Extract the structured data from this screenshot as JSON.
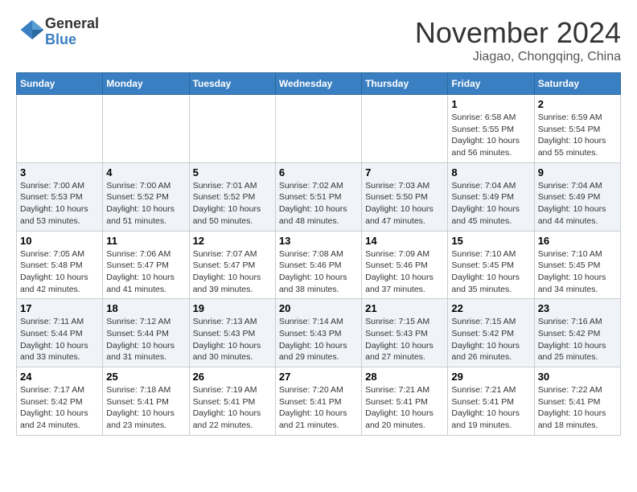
{
  "header": {
    "logo_line1": "General",
    "logo_line2": "Blue",
    "month": "November 2024",
    "location": "Jiagao, Chongqing, China"
  },
  "weekdays": [
    "Sunday",
    "Monday",
    "Tuesday",
    "Wednesday",
    "Thursday",
    "Friday",
    "Saturday"
  ],
  "weeks": [
    [
      {
        "day": "",
        "info": ""
      },
      {
        "day": "",
        "info": ""
      },
      {
        "day": "",
        "info": ""
      },
      {
        "day": "",
        "info": ""
      },
      {
        "day": "",
        "info": ""
      },
      {
        "day": "1",
        "info": "Sunrise: 6:58 AM\nSunset: 5:55 PM\nDaylight: 10 hours and 56 minutes."
      },
      {
        "day": "2",
        "info": "Sunrise: 6:59 AM\nSunset: 5:54 PM\nDaylight: 10 hours and 55 minutes."
      }
    ],
    [
      {
        "day": "3",
        "info": "Sunrise: 7:00 AM\nSunset: 5:53 PM\nDaylight: 10 hours and 53 minutes."
      },
      {
        "day": "4",
        "info": "Sunrise: 7:00 AM\nSunset: 5:52 PM\nDaylight: 10 hours and 51 minutes."
      },
      {
        "day": "5",
        "info": "Sunrise: 7:01 AM\nSunset: 5:52 PM\nDaylight: 10 hours and 50 minutes."
      },
      {
        "day": "6",
        "info": "Sunrise: 7:02 AM\nSunset: 5:51 PM\nDaylight: 10 hours and 48 minutes."
      },
      {
        "day": "7",
        "info": "Sunrise: 7:03 AM\nSunset: 5:50 PM\nDaylight: 10 hours and 47 minutes."
      },
      {
        "day": "8",
        "info": "Sunrise: 7:04 AM\nSunset: 5:49 PM\nDaylight: 10 hours and 45 minutes."
      },
      {
        "day": "9",
        "info": "Sunrise: 7:04 AM\nSunset: 5:49 PM\nDaylight: 10 hours and 44 minutes."
      }
    ],
    [
      {
        "day": "10",
        "info": "Sunrise: 7:05 AM\nSunset: 5:48 PM\nDaylight: 10 hours and 42 minutes."
      },
      {
        "day": "11",
        "info": "Sunrise: 7:06 AM\nSunset: 5:47 PM\nDaylight: 10 hours and 41 minutes."
      },
      {
        "day": "12",
        "info": "Sunrise: 7:07 AM\nSunset: 5:47 PM\nDaylight: 10 hours and 39 minutes."
      },
      {
        "day": "13",
        "info": "Sunrise: 7:08 AM\nSunset: 5:46 PM\nDaylight: 10 hours and 38 minutes."
      },
      {
        "day": "14",
        "info": "Sunrise: 7:09 AM\nSunset: 5:46 PM\nDaylight: 10 hours and 37 minutes."
      },
      {
        "day": "15",
        "info": "Sunrise: 7:10 AM\nSunset: 5:45 PM\nDaylight: 10 hours and 35 minutes."
      },
      {
        "day": "16",
        "info": "Sunrise: 7:10 AM\nSunset: 5:45 PM\nDaylight: 10 hours and 34 minutes."
      }
    ],
    [
      {
        "day": "17",
        "info": "Sunrise: 7:11 AM\nSunset: 5:44 PM\nDaylight: 10 hours and 33 minutes."
      },
      {
        "day": "18",
        "info": "Sunrise: 7:12 AM\nSunset: 5:44 PM\nDaylight: 10 hours and 31 minutes."
      },
      {
        "day": "19",
        "info": "Sunrise: 7:13 AM\nSunset: 5:43 PM\nDaylight: 10 hours and 30 minutes."
      },
      {
        "day": "20",
        "info": "Sunrise: 7:14 AM\nSunset: 5:43 PM\nDaylight: 10 hours and 29 minutes."
      },
      {
        "day": "21",
        "info": "Sunrise: 7:15 AM\nSunset: 5:43 PM\nDaylight: 10 hours and 27 minutes."
      },
      {
        "day": "22",
        "info": "Sunrise: 7:15 AM\nSunset: 5:42 PM\nDaylight: 10 hours and 26 minutes."
      },
      {
        "day": "23",
        "info": "Sunrise: 7:16 AM\nSunset: 5:42 PM\nDaylight: 10 hours and 25 minutes."
      }
    ],
    [
      {
        "day": "24",
        "info": "Sunrise: 7:17 AM\nSunset: 5:42 PM\nDaylight: 10 hours and 24 minutes."
      },
      {
        "day": "25",
        "info": "Sunrise: 7:18 AM\nSunset: 5:41 PM\nDaylight: 10 hours and 23 minutes."
      },
      {
        "day": "26",
        "info": "Sunrise: 7:19 AM\nSunset: 5:41 PM\nDaylight: 10 hours and 22 minutes."
      },
      {
        "day": "27",
        "info": "Sunrise: 7:20 AM\nSunset: 5:41 PM\nDaylight: 10 hours and 21 minutes."
      },
      {
        "day": "28",
        "info": "Sunrise: 7:21 AM\nSunset: 5:41 PM\nDaylight: 10 hours and 20 minutes."
      },
      {
        "day": "29",
        "info": "Sunrise: 7:21 AM\nSunset: 5:41 PM\nDaylight: 10 hours and 19 minutes."
      },
      {
        "day": "30",
        "info": "Sunrise: 7:22 AM\nSunset: 5:41 PM\nDaylight: 10 hours and 18 minutes."
      }
    ]
  ]
}
